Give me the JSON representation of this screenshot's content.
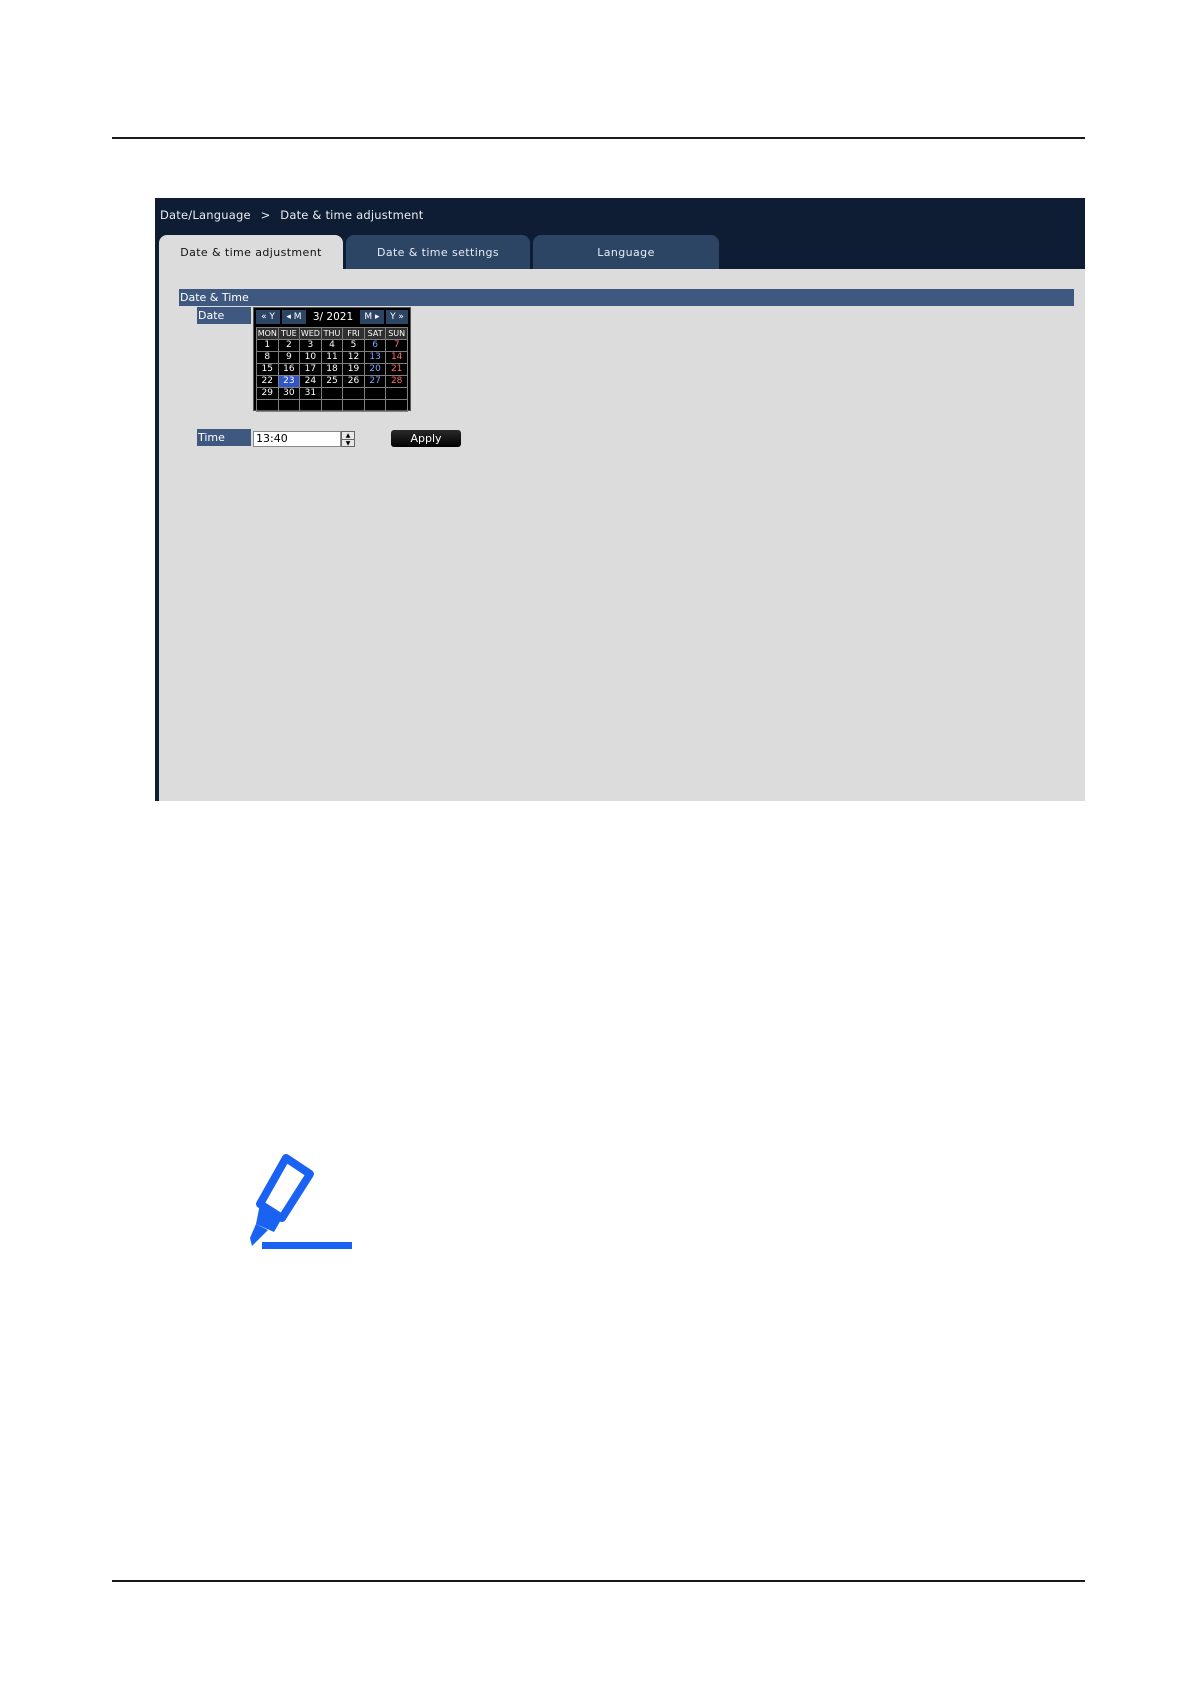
{
  "breadcrumb": {
    "parent": "Date/Language",
    "separator": ">",
    "current": "Date & time adjustment"
  },
  "tabs": [
    {
      "label": "Date & time adjustment",
      "active": true
    },
    {
      "label": "Date & time settings",
      "active": false
    },
    {
      "label": "Language",
      "active": false
    }
  ],
  "section": {
    "title": "Date & Time"
  },
  "date": {
    "label": "Date",
    "nav": {
      "prev_year": "« Y",
      "prev_month": "◂ M",
      "month_year": "3/ 2021",
      "next_month": "M ▸",
      "next_year": "Y »"
    },
    "weekdays": [
      "MON",
      "TUE",
      "WED",
      "THU",
      "FRI",
      "SAT",
      "SUN"
    ],
    "weeks": [
      [
        "1",
        "2",
        "3",
        "4",
        "5",
        "6",
        "7"
      ],
      [
        "8",
        "9",
        "10",
        "11",
        "12",
        "13",
        "14"
      ],
      [
        "15",
        "16",
        "17",
        "18",
        "19",
        "20",
        "21"
      ],
      [
        "22",
        "23",
        "24",
        "25",
        "26",
        "27",
        "28"
      ],
      [
        "29",
        "30",
        "31",
        "",
        "",
        "",
        ""
      ],
      [
        "",
        "",
        "",
        "",
        "",
        "",
        ""
      ]
    ],
    "selected": "23"
  },
  "time": {
    "label": "Time",
    "value": "13:40"
  },
  "apply_label": "Apply",
  "colors": {
    "screen_bg": "#0e1d33",
    "tab_inactive": "#2d4565",
    "label_bg": "#3f587f",
    "panel_bg": "#dcdcdc",
    "selected_day": "#2f55c8",
    "saturday": "#7fa3ff",
    "sunday": "#ff6b6b",
    "note_icon": "#1a62f2"
  },
  "icons": {
    "note": "highlighter-pen-icon",
    "spinner_up": "triangle-up-icon",
    "spinner_down": "triangle-down-icon"
  }
}
